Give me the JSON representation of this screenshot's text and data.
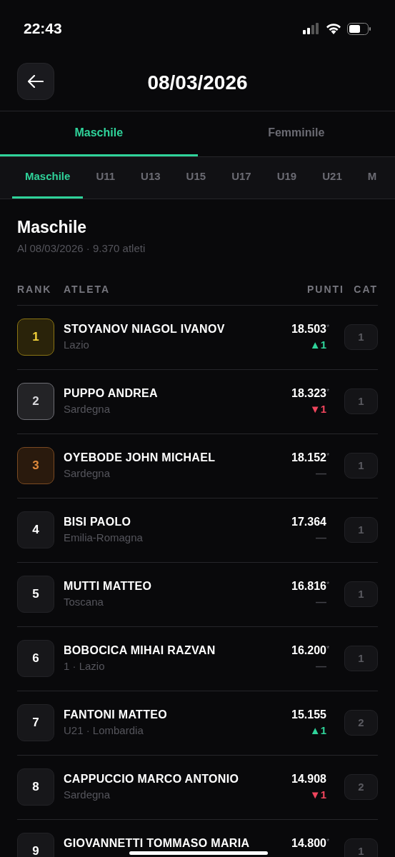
{
  "status_bar": {
    "time": "22:43"
  },
  "header": {
    "title": "08/03/2026"
  },
  "tabs": [
    {
      "label": "Maschile",
      "selected": true
    },
    {
      "label": "Femminile",
      "selected": false
    }
  ],
  "sub_tabs": [
    {
      "label": "Maschile",
      "selected": true
    },
    {
      "label": "U11",
      "selected": false
    },
    {
      "label": "U13",
      "selected": false
    },
    {
      "label": "U15",
      "selected": false
    },
    {
      "label": "U17",
      "selected": false
    },
    {
      "label": "U19",
      "selected": false
    },
    {
      "label": "U21",
      "selected": false
    },
    {
      "label": "M",
      "selected": false
    }
  ],
  "section": {
    "title": "Maschile",
    "subtitle": "Al 08/03/2026 · 9.370 atleti"
  },
  "table": {
    "columns": [
      "RANK",
      "ATLETA",
      "PUNTI",
      "CAT"
    ],
    "rows": [
      {
        "rank": "1",
        "kind": "gold",
        "name": "STOYANOV NIAGOL IVANOV",
        "detail": "Lazio",
        "points": "18.503",
        "note": "*",
        "change": {
          "text": "▲1",
          "color": "#2fd39a"
        },
        "cat": "1"
      },
      {
        "rank": "2",
        "kind": "silver",
        "name": "PUPPO ANDREA",
        "detail": "Sardegna",
        "points": "18.323",
        "note": "*",
        "change": {
          "text": "▼1",
          "color": "#f0455d"
        },
        "cat": "1"
      },
      {
        "rank": "3",
        "kind": "bronze",
        "name": "OYEBODE JOHN MICHAEL",
        "detail": "Sardegna",
        "points": "18.152",
        "note": "*",
        "change": {
          "text": "—",
          "color": "#44444a"
        },
        "cat": "1"
      },
      {
        "rank": "4",
        "kind": "plain",
        "name": "BISI PAOLO",
        "detail": "Emilia-Romagna",
        "points": "17.364",
        "change": {
          "text": "—",
          "color": "#44444a"
        },
        "cat": "1"
      },
      {
        "rank": "5",
        "kind": "plain",
        "name": "MUTTI MATTEO",
        "detail": "Toscana",
        "points": "16.816",
        "note": "*",
        "change": {
          "text": "—",
          "color": "#44444a"
        },
        "cat": "1"
      },
      {
        "rank": "6",
        "kind": "plain",
        "name": "BOBOCICA MIHAI RAZVAN",
        "detail": "1 · Lazio",
        "points": "16.200",
        "note": "*",
        "change": {
          "text": "—",
          "color": "#44444a"
        },
        "cat": "1"
      },
      {
        "rank": "7",
        "kind": "plain",
        "name": "FANTONI MATTEO",
        "detail": "U21 · Lombardia",
        "points": "15.155",
        "change": {
          "text": "▲1",
          "color": "#2fd39a"
        },
        "cat": "2"
      },
      {
        "rank": "8",
        "kind": "plain",
        "name": "CAPPUCCIO MARCO ANTONIO",
        "detail": "Sardegna",
        "points": "14.908",
        "change": {
          "text": "▼1",
          "color": "#f0455d"
        },
        "cat": "2"
      },
      {
        "rank": "9",
        "kind": "plain",
        "name": "GIOVANNETTI TOMMASO MARIA",
        "points": "14.800",
        "note": "*",
        "cat": "1"
      }
    ]
  }
}
